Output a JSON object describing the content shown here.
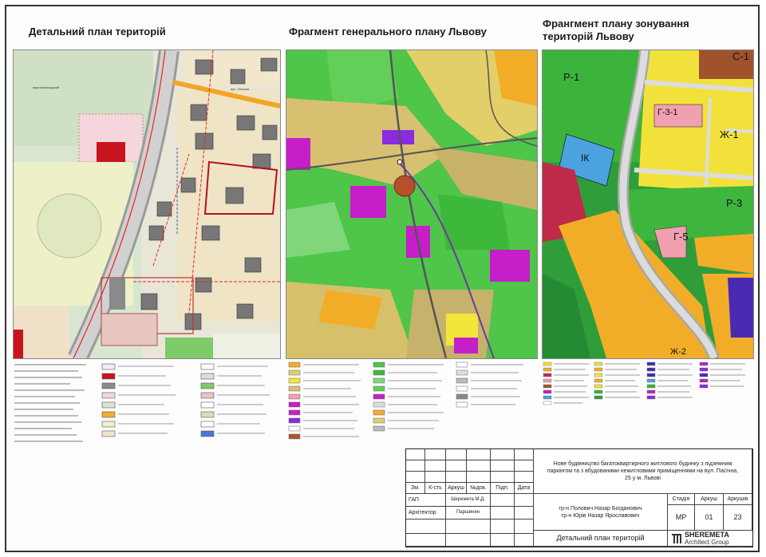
{
  "panels": {
    "left_title": "Детальний план територій",
    "middle_title": "Фрагмент генерального плану Львову",
    "right_title_line1": "Франгмент плану зонування",
    "right_title_line2": "територій Львову"
  },
  "zoning_labels": {
    "r1": "Р-1",
    "c1": "С-1",
    "g31": "Г-3-1",
    "zh1": "Ж-1",
    "ik": "ІК",
    "r3": "Р-3",
    "g5": "Г-5",
    "zh2": "Ж-2"
  },
  "map_labels": {
    "park": "парк Кисасицький",
    "street": "вул. Пасічна"
  },
  "stamp": {
    "description": "Нове будівництво багатоквартирного житлового будинку з підземним паркінгом та з вбудованими нежитловими приміщеннями на вул. Пасічна, 25 у м. Львові",
    "headers": [
      "Зм.",
      "К-сть",
      "Аркуш",
      "№док.",
      "Підп.",
      "Дата"
    ],
    "gap_label": "ГАП",
    "architect_label": "Архітектор",
    "gap_name": "Шеремета М.Д.",
    "architect_name": "Паршинян",
    "client_line1": "гр-н Полович Назар Богданович",
    "client_line2": "гр-н Юрів Назар Ярославович",
    "stage_label": "Стадія",
    "sheet_label": "Аркуш",
    "sheets_label": "Аркушів",
    "stage_value": "МР",
    "sheet_value": "01",
    "sheets_value": "23",
    "drawing_title": "Детальний план територій",
    "company_line1": "SHEREMETA",
    "company_line2": "Architect Group"
  },
  "colors": {
    "green": "#3fbf3f",
    "yellow": "#f4e53a",
    "orange": "#f2ad28",
    "magenta": "#c61ec9",
    "blue_ik": "#4aa3df",
    "dark_green": "#1f8f36",
    "pink": "#f1a0b0",
    "brown": "#a0522d"
  }
}
